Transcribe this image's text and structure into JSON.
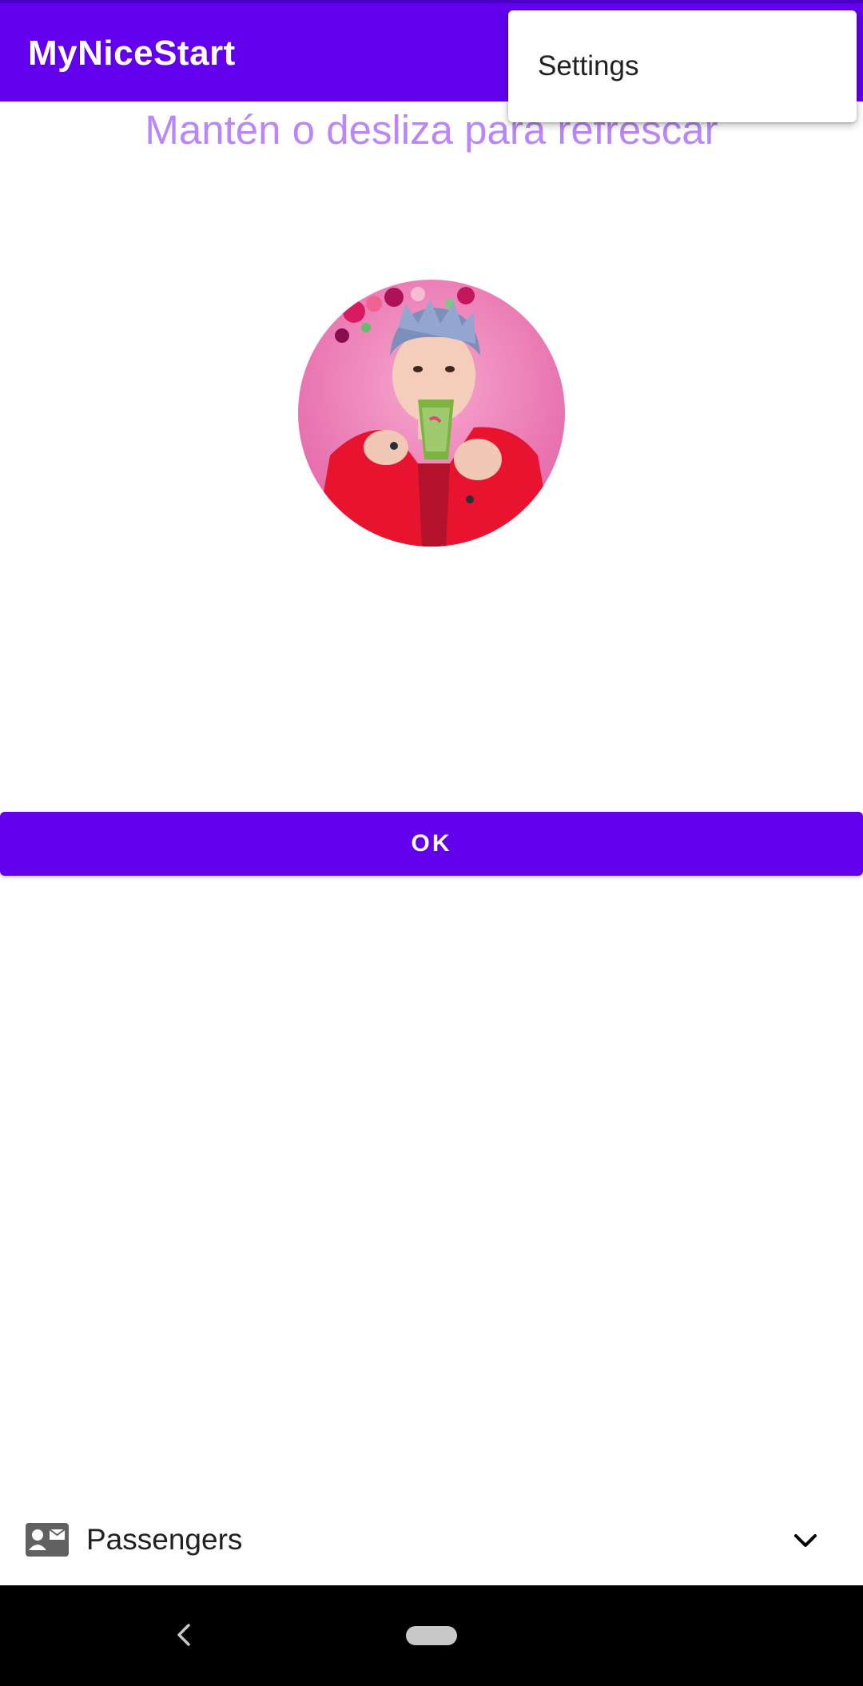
{
  "app_bar": {
    "title": "MyNiceStart",
    "color": "#6200EE"
  },
  "overflow_menu": {
    "items": [
      {
        "label": "Settings"
      }
    ]
  },
  "main": {
    "refresh_hint": "Mantén o desliza para refrescar",
    "hint_color": "#BB86FC",
    "avatar_icon": "profile-photo",
    "ok_button_label": "OK"
  },
  "bottom_row": {
    "icon": "contact-mail-icon",
    "label": "Passengers",
    "chevron": "chevron-down-icon"
  },
  "nav_bar": {
    "back_icon": "back-icon",
    "home_icon": "home-pill-icon"
  }
}
